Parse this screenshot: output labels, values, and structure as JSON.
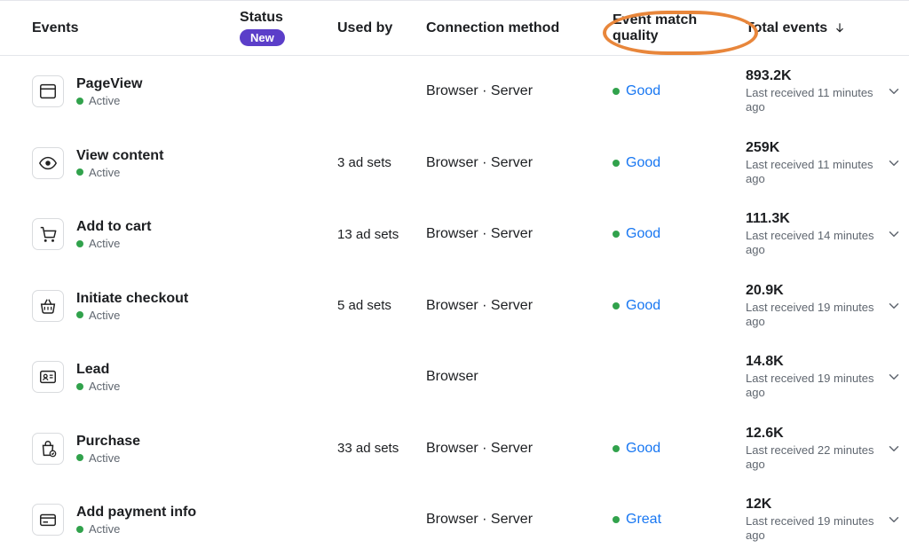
{
  "columns": {
    "events": "Events",
    "status": "Status",
    "status_badge": "New",
    "usedby": "Used by",
    "connection": "Connection method",
    "quality": "Event match quality",
    "total": "Total events"
  },
  "status_active": "Active",
  "rows": [
    {
      "icon": "window",
      "name": "PageView",
      "usedby": "",
      "connection": "Browser · Server",
      "quality": "Good",
      "quality_dot": true,
      "total": "893.2K",
      "last": "Last received 11 minutes ago"
    },
    {
      "icon": "eye",
      "name": "View content",
      "usedby": "3 ad sets",
      "connection": "Browser · Server",
      "quality": "Good",
      "quality_dot": true,
      "total": "259K",
      "last": "Last received 11 minutes ago"
    },
    {
      "icon": "cart",
      "name": "Add to cart",
      "usedby": "13 ad sets",
      "connection": "Browser · Server",
      "quality": "Good",
      "quality_dot": true,
      "total": "111.3K",
      "last": "Last received 14 minutes ago"
    },
    {
      "icon": "basket",
      "name": "Initiate checkout",
      "usedby": "5 ad sets",
      "connection": "Browser · Server",
      "quality": "Good",
      "quality_dot": true,
      "total": "20.9K",
      "last": "Last received 19 minutes ago"
    },
    {
      "icon": "idcard",
      "name": "Lead",
      "usedby": "",
      "connection": "Browser",
      "quality": "",
      "quality_dot": false,
      "total": "14.8K",
      "last": "Last received 19 minutes ago"
    },
    {
      "icon": "bag",
      "name": "Purchase",
      "usedby": "33 ad sets",
      "connection": "Browser · Server",
      "quality": "Good",
      "quality_dot": true,
      "total": "12.6K",
      "last": "Last received 22 minutes ago"
    },
    {
      "icon": "card",
      "name": "Add payment info",
      "usedby": "",
      "connection": "Browser · Server",
      "quality": "Great",
      "quality_dot": true,
      "total": "12K",
      "last": "Last received 19 minutes ago"
    }
  ]
}
